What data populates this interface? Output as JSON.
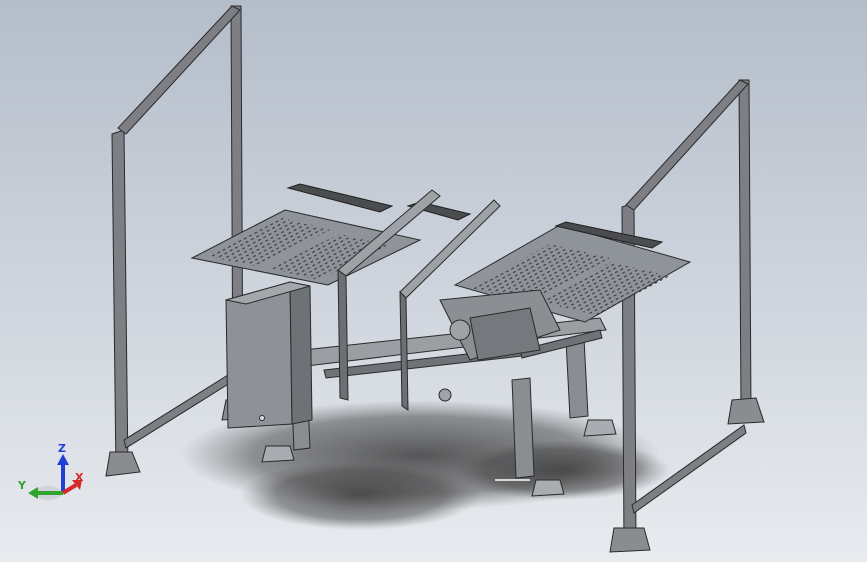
{
  "viewport": {
    "background_top": "#b4bdca",
    "background_bottom": "#e8ebef",
    "shadow_color": "#2b2b2b",
    "frame_color": "#7d7f84",
    "frame_edge": "#2a2a2a",
    "panel_color": "#8f939a",
    "perforation_color": "#3c3f44"
  },
  "triad": {
    "axes": [
      {
        "label": "Z",
        "color": "#1f3fd6"
      },
      {
        "label": "Y",
        "color": "#2fa52f"
      },
      {
        "label": "X",
        "color": "#d62a2a"
      }
    ]
  }
}
